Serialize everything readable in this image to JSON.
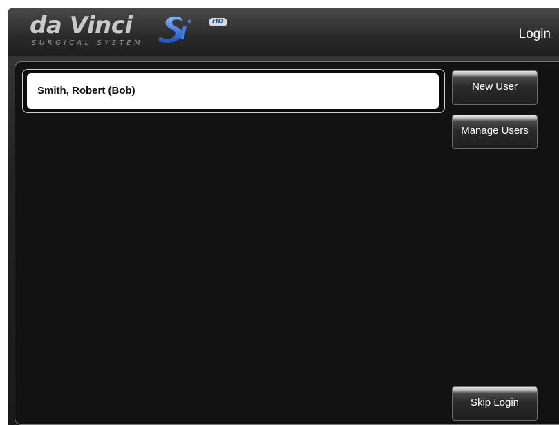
{
  "header": {
    "logo_main": "da Vinci",
    "logo_sub": "SURGICAL SYSTEM",
    "logo_hd": "HD",
    "title": "Login"
  },
  "users": [
    {
      "name": "Smith, Robert (Bob)"
    }
  ],
  "buttons": {
    "new_user": "New User",
    "manage_users": "Manage Users",
    "skip_login": "Skip Login"
  },
  "colors": {
    "background": "#121212",
    "header": "#2a2a2a",
    "selected_item": "#ffffff",
    "logo_accent": "#1e4fa8"
  }
}
